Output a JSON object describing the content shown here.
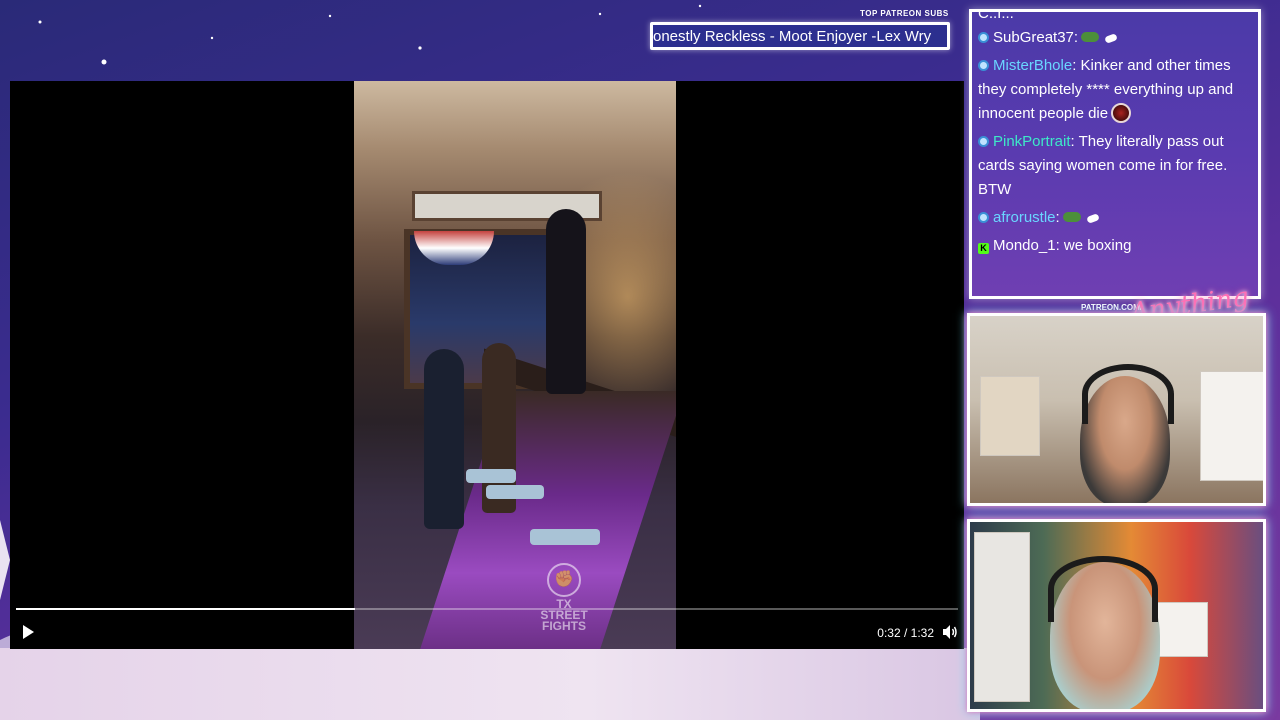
{
  "ticker": {
    "label": "TOP PATREON SUBS",
    "text": "onestly Reckless - Moot Enjoyer -Lex Wry"
  },
  "player": {
    "progress_fraction": 0.36,
    "time": "0:32 / 1:32",
    "play_icon": "play-icon",
    "volume_icon": "volume-icon",
    "watermark_line1": "TX STREET",
    "watermark_line2": "FIGHTS"
  },
  "chat": {
    "cut_text": "C..I...",
    "messages": [
      {
        "user": "SubGreat37",
        "user_color": "#ffffff",
        "sep": ":",
        "text": "",
        "emotes": [
          "frog-emote",
          "white-emote"
        ],
        "badge": "twitch"
      },
      {
        "user": "MisterBhole",
        "user_color": "#6ad6ff",
        "sep": ":",
        "text": " Kinker and other times they completely **** everything up and innocent people die",
        "emotes": [
          "ball-emote"
        ],
        "badge": "twitch"
      },
      {
        "user": "PinkPortrait",
        "user_color": "#3ee8c8",
        "sep": ":",
        "text": " They literally pass out cards saying women come in for free. BTW",
        "emotes": [],
        "badge": "twitch"
      },
      {
        "user": "afrorustle",
        "user_color": "#6ad6ff",
        "sep": ":",
        "text": "",
        "emotes": [
          "frog-emote",
          "white-emote"
        ],
        "badge": "twitch"
      },
      {
        "user": "Mondo_1",
        "user_color": "#ffffff",
        "sep": ":",
        "text": " we boxing",
        "emotes": [],
        "badge": "kick"
      }
    ]
  },
  "branding": {
    "patreon_url": "PATREON.COM/",
    "logo_text": "Anything Else"
  },
  "colors": {
    "accent_pink": "#ff6fb5",
    "accent_cyan": "#6cf0ff",
    "chat_bg": "#5a3bb0"
  }
}
